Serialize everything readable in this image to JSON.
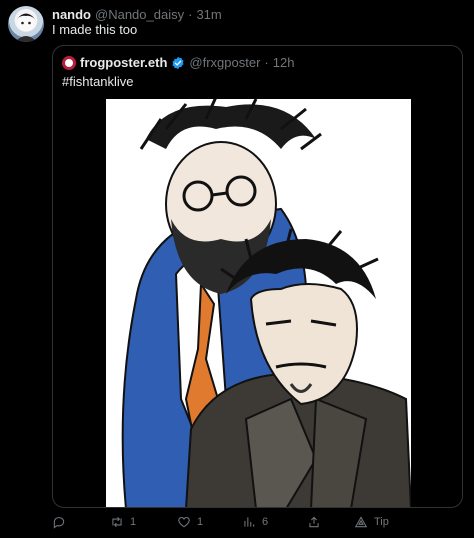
{
  "post": {
    "display_name": "nando",
    "handle": "@Nando_daisy",
    "separator": "·",
    "time": "31m",
    "text": "I made this too"
  },
  "quote": {
    "display_name": "frogposter.eth",
    "handle": "@frxgposter",
    "separator": "·",
    "time": "12h",
    "text": "#fishtanklive",
    "verified_color": "#1d9bf0"
  },
  "actions": {
    "reply_count": "",
    "repost_count": "1",
    "like_count": "1",
    "views_count": "6",
    "tip_label": "Tip"
  },
  "icons": [
    "reply-icon",
    "repost-icon",
    "like-icon",
    "views-icon",
    "share-icon",
    "tip-icon",
    "verified-icon"
  ],
  "colors": {
    "background": "#000000",
    "text": "#e7e9ea",
    "muted": "#71767b",
    "border": "#2f3336"
  }
}
